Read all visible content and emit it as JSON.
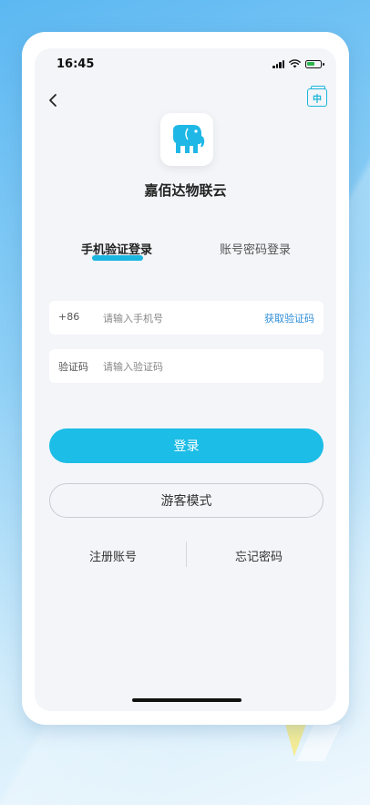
{
  "status_bar": {
    "time": "16:45"
  },
  "header": {
    "lang_icon_label": "中"
  },
  "app": {
    "name": "嘉佰达物联云"
  },
  "tabs": {
    "phone_login": "手机验证登录",
    "account_login": "账号密码登录",
    "active": "phone_login"
  },
  "form": {
    "phone_prefix": "+86",
    "phone_placeholder": "请输入手机号",
    "get_code": "获取验证码",
    "code_label": "验证码",
    "code_placeholder": "请输入验证码"
  },
  "buttons": {
    "login": "登录",
    "guest": "游客模式"
  },
  "links": {
    "register": "注册账号",
    "forgot": "忘记密码"
  },
  "colors": {
    "accent": "#1cbde6",
    "link": "#2f8ed8",
    "background": "#f3f5f9"
  }
}
